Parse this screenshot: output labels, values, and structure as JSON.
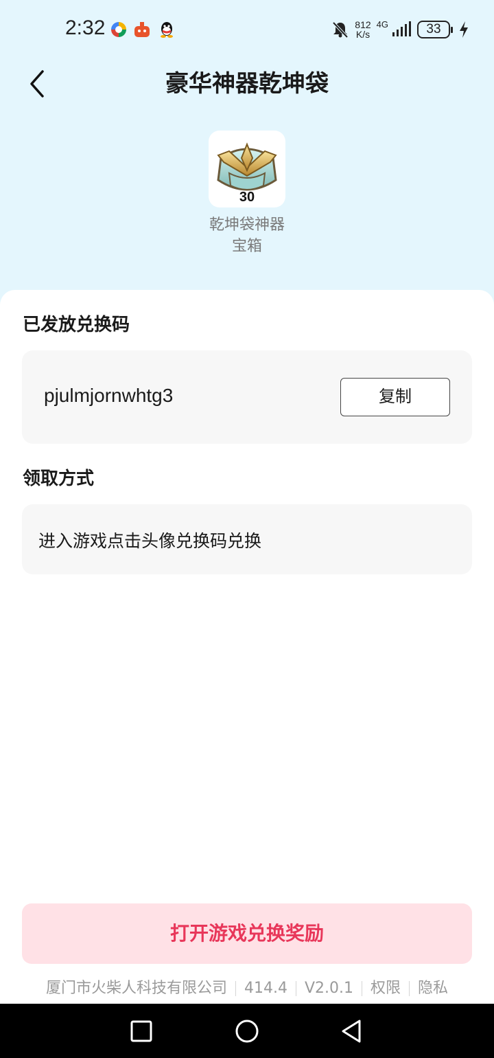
{
  "status_bar": {
    "time": "2:32",
    "net_speed_value": "812",
    "net_speed_unit": "K/s",
    "network_type": "4G",
    "battery_level": "33",
    "app_icons": [
      "browser-icon",
      "game-icon",
      "qq-icon"
    ],
    "system_icons": [
      "mute-bell-icon",
      "signal-icon",
      "charging-icon"
    ]
  },
  "header": {
    "title": "豪华神器乾坤袋",
    "back_icon": "chevron-left-icon"
  },
  "reward": {
    "icon": "treasure-chest-icon",
    "quantity": "30",
    "name_line1": "乾坤袋神器",
    "name_line2": "宝箱"
  },
  "code_section": {
    "title": "已发放兑换码",
    "code": "pjulmjornwhtg3",
    "copy_label": "复制"
  },
  "method_section": {
    "title": "领取方式",
    "description": "进入游戏点击头像兑换码兑换"
  },
  "open_button_label": "打开游戏兑换奖励",
  "footer": {
    "company": "厦门市火柴人科技有限公司",
    "build": "414.4",
    "version": "V2.0.1",
    "permissions": "权限",
    "privacy": "隐私"
  },
  "colors": {
    "header_bg": "#e4f6fd",
    "accent": "#e8375a",
    "accent_bg": "#ffe1e6"
  }
}
